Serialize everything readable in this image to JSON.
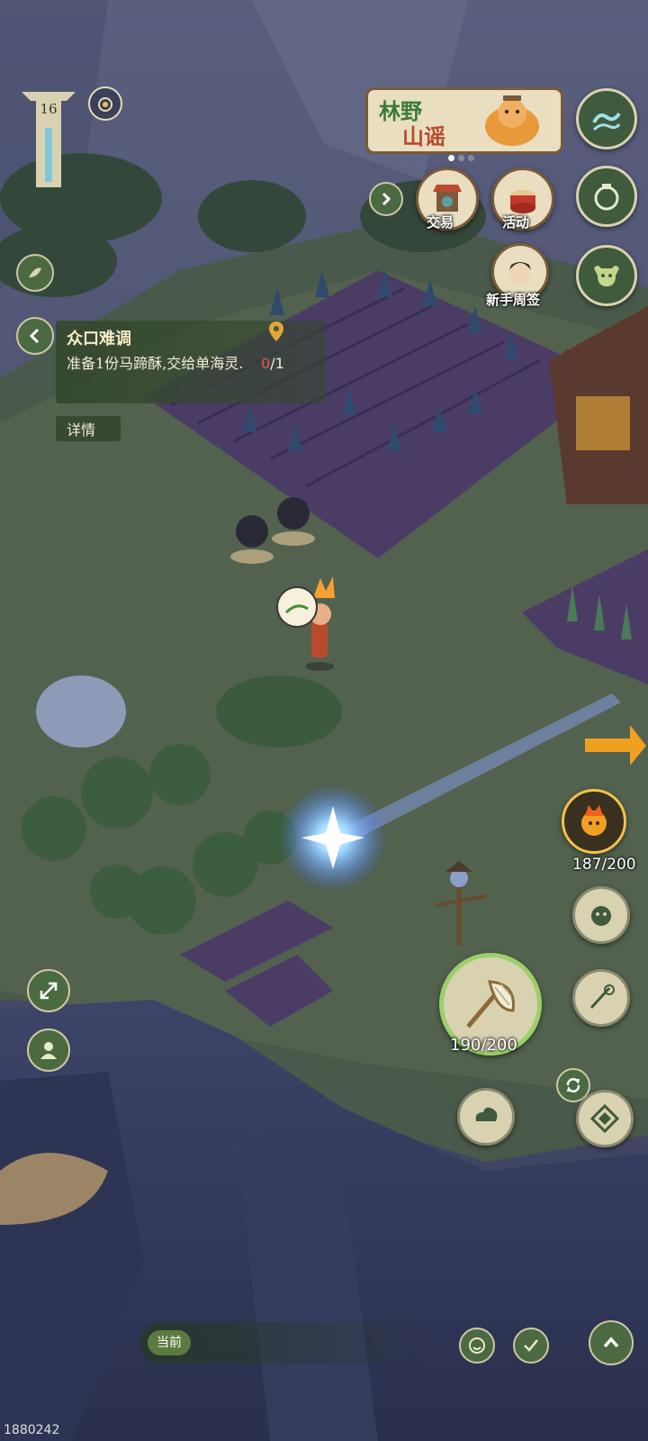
{
  "level": {
    "value": "16"
  },
  "banner": {
    "line1": "林野",
    "line2": "山谣"
  },
  "top_menu": {
    "trade_label": "交易",
    "activity_label": "活动",
    "newbie_label": "新手周签"
  },
  "quest": {
    "title": "众口难调",
    "description": "准备1份马蹄酥,交给单海灵.",
    "progress_current": "0",
    "progress_total": "/1",
    "details_label": "详情"
  },
  "counters": {
    "stamina": "187/200",
    "net": "190/200"
  },
  "chat": {
    "channel_label": "当前"
  },
  "version": "1880242",
  "colors": {
    "hud_green": "#3f5a3c",
    "hud_border": "#d9d2b0",
    "progress_red": "#e05a4c",
    "accent_orange": "#f0a020"
  }
}
